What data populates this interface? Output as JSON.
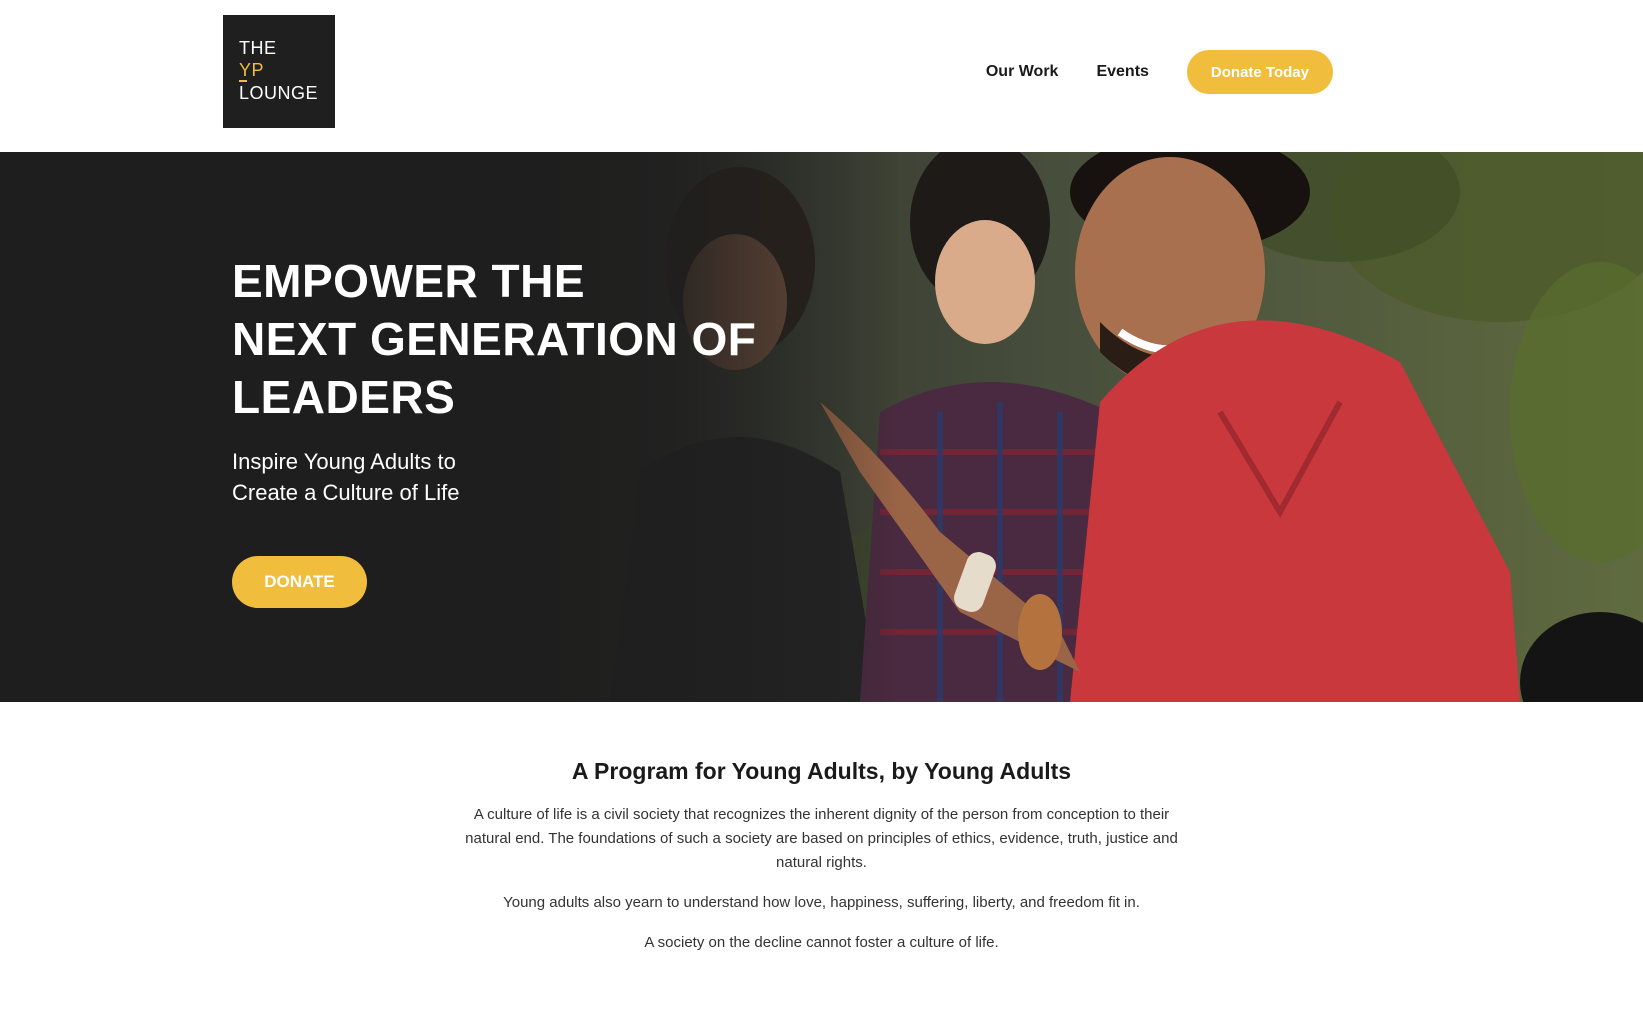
{
  "header": {
    "logo": {
      "line1": "THE",
      "line2": "YP",
      "line3": "LOUNGE"
    },
    "nav": [
      {
        "label": "Our Work"
      },
      {
        "label": "Events"
      }
    ],
    "cta_label": "Donate Today"
  },
  "hero": {
    "title_lines": [
      "EMPOWER THE",
      "NEXT GENERATION OF",
      "LEADERS"
    ],
    "subtitle_lines": [
      "Inspire Young Adults to",
      "Create a Culture of Life"
    ],
    "button_label": "DONATE"
  },
  "intro": {
    "title": "A Program for Young Adults, by Young Adults",
    "paragraphs": [
      "A culture of life is a civil society that recognizes the inherent dignity of the person from conception to their natural end. The foundations of such a society are based on principles of ethics, evidence, truth, justice and natural rights.",
      "Young adults also yearn to understand how love, happiness, suffering, liberty, and freedom fit in.",
      "A society on the decline cannot foster a culture of life."
    ]
  },
  "colors": {
    "accent": "#f0bd3c",
    "dark": "#1e1e1e",
    "text": "#1a1a1a"
  }
}
